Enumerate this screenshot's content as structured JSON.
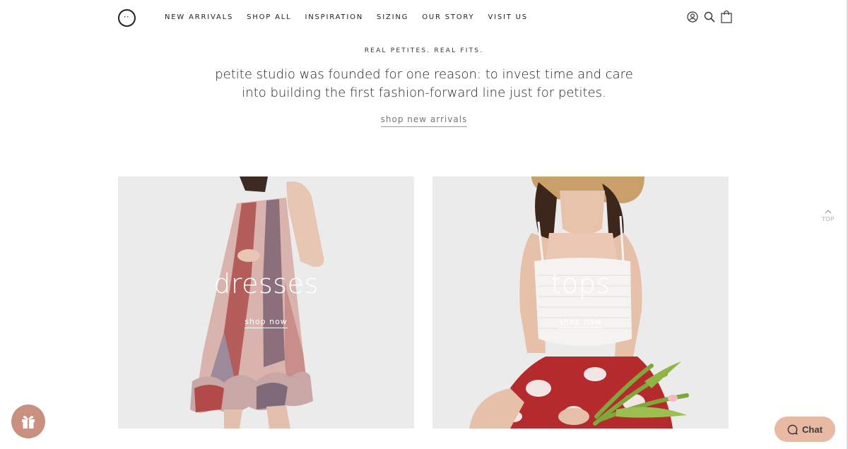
{
  "header": {
    "logo_alt": "petite studio",
    "nav": [
      {
        "label": "NEW ARRIVALS"
      },
      {
        "label": "SHOP ALL"
      },
      {
        "label": "INSPIRATION"
      },
      {
        "label": "SIZING"
      },
      {
        "label": "OUR STORY"
      },
      {
        "label": "VISIT US"
      }
    ],
    "icons": [
      "account-icon",
      "search-icon",
      "cart-bag-icon"
    ]
  },
  "intro": {
    "eyebrow": "REAL PETITES. REAL FITS.",
    "text": "petite studio was founded for one reason: to invest time and care into building the first fashion-forward line just for petites.",
    "link": "shop new arrivals"
  },
  "tiles": [
    {
      "title": "dresses",
      "cta": "shop now"
    },
    {
      "title": "tops",
      "cta": "shop now"
    }
  ],
  "back_to_top": {
    "label": "TOP"
  },
  "chat": {
    "label": "Chat"
  },
  "colors": {
    "gift_button": "#c98f7f",
    "chat_button": "#eab9a3",
    "tile_background": "#ecebec"
  }
}
